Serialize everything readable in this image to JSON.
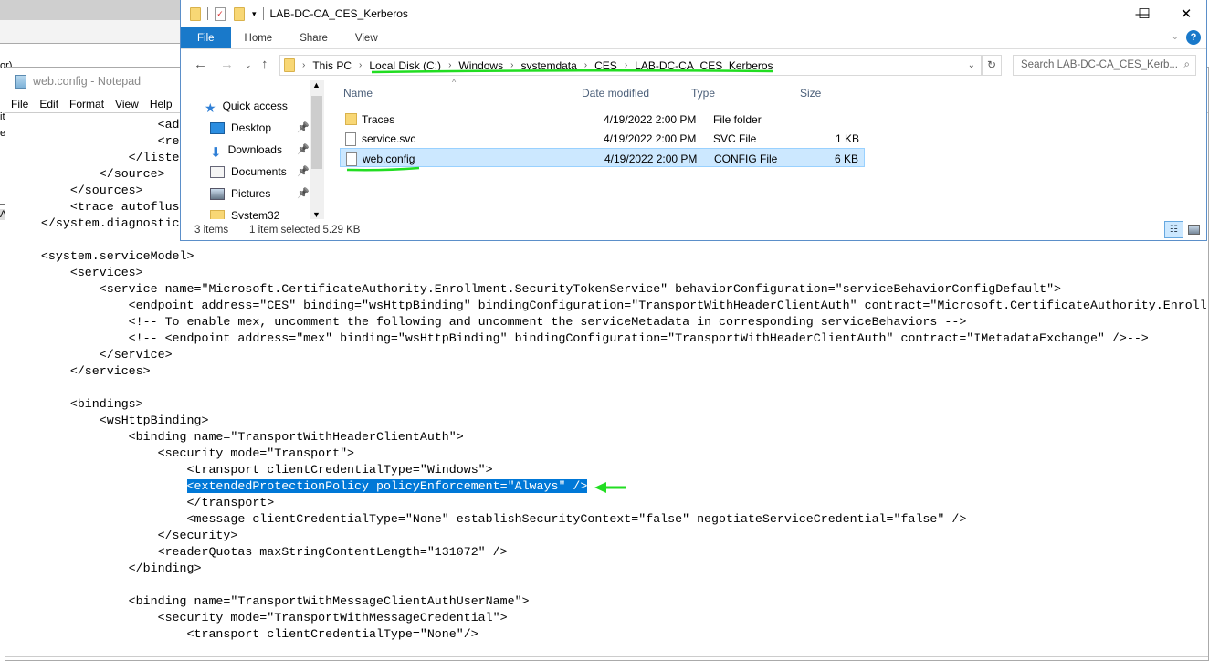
{
  "background_window": {
    "fragments": [
      "or)",
      "it",
      "er",
      "_a",
      "A"
    ]
  },
  "notepad": {
    "title": "web.config - Notepad",
    "menu": [
      "File",
      "Edit",
      "Format",
      "View",
      "Help"
    ],
    "lines": [
      {
        "text": "                    <ad"
      },
      {
        "text": "                    <re"
      },
      {
        "text": "                </liste"
      },
      {
        "text": "            </source>"
      },
      {
        "text": "        </sources>"
      },
      {
        "text": "        <trace autoflus"
      },
      {
        "text": "    </system.diagnostic"
      },
      {
        "text": ""
      },
      {
        "text": "    <system.serviceModel>"
      },
      {
        "text": "        <services>"
      },
      {
        "text": "            <service name=\"Microsoft.CertificateAuthority.Enrollment.SecurityTokenService\" behaviorConfiguration=\"serviceBehaviorConfigDefault\">"
      },
      {
        "text": "                <endpoint address=\"CES\" binding=\"wsHttpBinding\" bindingConfiguration=\"TransportWithHeaderClientAuth\" contract=\"Microsoft.CertificateAuthority.Enroll"
      },
      {
        "text": "                <!-- To enable mex, uncomment the following and uncomment the serviceMetadata in corresponding serviceBehaviors -->"
      },
      {
        "text": "                <!-- <endpoint address=\"mex\" binding=\"wsHttpBinding\" bindingConfiguration=\"TransportWithHeaderClientAuth\" contract=\"IMetadataExchange\" />-->"
      },
      {
        "text": "            </service>"
      },
      {
        "text": "        </services>"
      },
      {
        "text": ""
      },
      {
        "text": "        <bindings>"
      },
      {
        "text": "            <wsHttpBinding>"
      },
      {
        "text": "                <binding name=\"TransportWithHeaderClientAuth\">"
      },
      {
        "text": "                    <security mode=\"Transport\">"
      },
      {
        "text": "                        <transport clientCredentialType=\"Windows\">"
      },
      {
        "text": "                        ",
        "selected": "<extendedProtectionPolicy policyEnforcement=\"Always\" />"
      },
      {
        "text": "                        </transport>"
      },
      {
        "text": "                        <message clientCredentialType=\"None\" establishSecurityContext=\"false\" negotiateServiceCredential=\"false\" />"
      },
      {
        "text": "                    </security>"
      },
      {
        "text": "                    <readerQuotas maxStringContentLength=\"131072\" />"
      },
      {
        "text": "                </binding>"
      },
      {
        "text": ""
      },
      {
        "text": "                <binding name=\"TransportWithMessageClientAuthUserName\">"
      },
      {
        "text": "                    <security mode=\"TransportWithMessageCredential\">"
      },
      {
        "text": "                        <transport clientCredentialType=\"None\"/>"
      }
    ],
    "selection_color": "#0078d7"
  },
  "explorer": {
    "title": "LAB-DC-CA_CES_Kerberos",
    "window_buttons": {
      "minimize": "—",
      "maximize": "☐",
      "close": "✕"
    },
    "ribbon_tabs": [
      "File",
      "Home",
      "Share",
      "View"
    ],
    "help": "?",
    "breadcrumb": [
      "This PC",
      "Local Disk (C:)",
      "Windows",
      "systemdata",
      "CES",
      "LAB-DC-CA_CES_Kerberos"
    ],
    "search_placeholder": "Search LAB-DC-CA_CES_Kerb...",
    "nav_pane": [
      {
        "label": "Quick access",
        "icon": "star-icon"
      },
      {
        "label": "Desktop",
        "icon": "desktop-icon",
        "pinned": true
      },
      {
        "label": "Downloads",
        "icon": "download-icon",
        "pinned": true
      },
      {
        "label": "Documents",
        "icon": "documents-icon",
        "pinned": true
      },
      {
        "label": "Pictures",
        "icon": "pictures-icon",
        "pinned": true
      },
      {
        "label": "System32",
        "icon": "folder-icon"
      }
    ],
    "columns": [
      "Name",
      "Date modified",
      "Type",
      "Size"
    ],
    "files": [
      {
        "name": "Traces",
        "date": "4/19/2022 2:00 PM",
        "type": "File folder",
        "size": "",
        "icon": "folder-icon"
      },
      {
        "name": "service.svc",
        "date": "4/19/2022 2:00 PM",
        "type": "SVC File",
        "size": "1 KB",
        "icon": "file-icon"
      },
      {
        "name": "web.config",
        "date": "4/19/2022 2:00 PM",
        "type": "CONFIG File",
        "size": "6 KB",
        "icon": "file-icon",
        "selected": true
      }
    ],
    "status": {
      "items": "3 items",
      "selected": "1 item selected  5.29 KB"
    }
  },
  "annotation_color": "#22dd22"
}
